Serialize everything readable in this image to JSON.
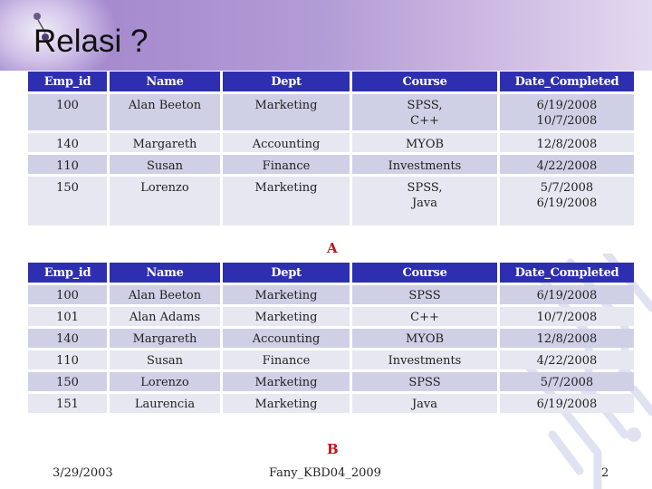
{
  "slide": {
    "title": "Relasi ?"
  },
  "columns": [
    "Emp_id",
    "Name",
    "Dept",
    "Course",
    "Date_Completed"
  ],
  "table_a": {
    "label": "A",
    "rows": [
      {
        "emp_id": "100",
        "name": "Alan Beeton",
        "dept": "Marketing",
        "course": [
          "SPSS,",
          "C++"
        ],
        "date": [
          "6/19/2008",
          "10/7/2008"
        ]
      },
      {
        "emp_id": "140",
        "name": "Margareth",
        "dept": "Accounting",
        "course": [
          "MYOB"
        ],
        "date": [
          "12/8/2008"
        ]
      },
      {
        "emp_id": "110",
        "name": "Susan",
        "dept": "Finance",
        "course": [
          "Investments"
        ],
        "date": [
          "4/22/2008"
        ]
      },
      {
        "emp_id": "150",
        "name": "Lorenzo",
        "dept": "Marketing",
        "course": [
          "SPSS,",
          "Java"
        ],
        "date": [
          "5/7/2008",
          "6/19/2008"
        ]
      }
    ]
  },
  "table_b": {
    "label": "B",
    "rows": [
      {
        "emp_id": "100",
        "name": "Alan Beeton",
        "dept": "Marketing",
        "course": "SPSS",
        "date": "6/19/2008"
      },
      {
        "emp_id": "101",
        "name": "Alan Adams",
        "dept": "Marketing",
        "course": "C++",
        "date": "10/7/2008"
      },
      {
        "emp_id": "140",
        "name": "Margareth",
        "dept": "Accounting",
        "course": "MYOB",
        "date": "12/8/2008"
      },
      {
        "emp_id": "110",
        "name": "Susan",
        "dept": "Finance",
        "course": "Investments",
        "date": "4/22/2008"
      },
      {
        "emp_id": "150",
        "name": "Lorenzo",
        "dept": "Marketing",
        "course": "SPSS",
        "date": "5/7/2008"
      },
      {
        "emp_id": "151",
        "name": "Laurencia",
        "dept": "Marketing",
        "course": "Java",
        "date": "6/19/2008"
      }
    ]
  },
  "footer": {
    "date": "3/29/2003",
    "center": "Fany_KBD04_2009",
    "page": "2"
  },
  "colors": {
    "header_bg": "#2e2eb0",
    "row_odd": "#cfd0e6",
    "row_even": "#e6e7f1",
    "label_red": "#c0141c",
    "title_band": "#a98ed0"
  }
}
